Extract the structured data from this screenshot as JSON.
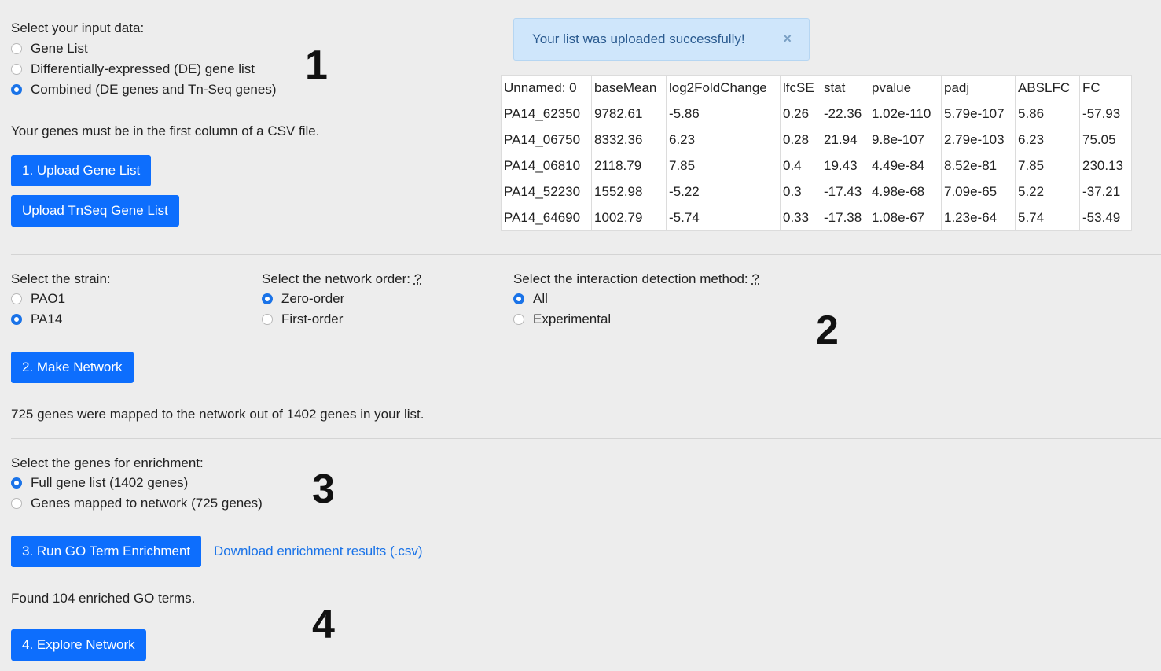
{
  "section1": {
    "prompt": "Select your input data:",
    "options": [
      "Gene List",
      "Differentially-expressed (DE) gene list",
      "Combined (DE genes and Tn-Seq genes)"
    ],
    "selected_index": 2,
    "note": "Your genes must be in the first column of a CSV file.",
    "upload_button": "1. Upload Gene List",
    "upload_tnseq_button": "Upload TnSeq Gene List",
    "marker": "1"
  },
  "alert": {
    "message": "Your list was uploaded successfully!",
    "close_glyph": "×"
  },
  "table": {
    "headers": [
      "Unnamed: 0",
      "baseMean",
      "log2FoldChange",
      "lfcSE",
      "stat",
      "pvalue",
      "padj",
      "ABSLFC",
      "FC"
    ],
    "rows": [
      [
        "PA14_62350",
        "9782.61",
        "-5.86",
        "0.26",
        "-22.36",
        "1.02e-110",
        "5.79e-107",
        "5.86",
        "-57.93"
      ],
      [
        "PA14_06750",
        "8332.36",
        "6.23",
        "0.28",
        "21.94",
        "9.8e-107",
        "2.79e-103",
        "6.23",
        "75.05"
      ],
      [
        "PA14_06810",
        "2118.79",
        "7.85",
        "0.4",
        "19.43",
        "4.49e-84",
        "8.52e-81",
        "7.85",
        "230.13"
      ],
      [
        "PA14_52230",
        "1552.98",
        "-5.22",
        "0.3",
        "-17.43",
        "4.98e-68",
        "7.09e-65",
        "5.22",
        "-37.21"
      ],
      [
        "PA14_64690",
        "1002.79",
        "-5.74",
        "0.33",
        "-17.38",
        "1.08e-67",
        "1.23e-64",
        "5.74",
        "-53.49"
      ]
    ]
  },
  "section2": {
    "strain_prompt": "Select the strain:",
    "strain_options": [
      "PAO1",
      "PA14"
    ],
    "strain_selected_index": 1,
    "order_prompt": "Select the network order:",
    "order_options": [
      "Zero-order",
      "First-order"
    ],
    "order_selected_index": 0,
    "method_prompt": "Select the interaction detection method:",
    "method_options": [
      "All",
      "Experimental"
    ],
    "method_selected_index": 0,
    "help_glyph": "?",
    "make_button": "2. Make Network",
    "mapped_text": "725 genes were mapped to the network out of 1402 genes in your list.",
    "marker": "2"
  },
  "section3": {
    "prompt": "Select the genes for enrichment:",
    "options": [
      "Full gene list (1402 genes)",
      "Genes mapped to network (725 genes)"
    ],
    "selected_index": 0,
    "run_button": "3. Run GO Term Enrichment",
    "download_link": "Download enrichment results (.csv)",
    "found_text": "Found 104 enriched GO terms.",
    "marker": "3"
  },
  "section4": {
    "explore_button": "4. Explore Network",
    "marker": "4"
  },
  "colors": {
    "button": "#0d6efd",
    "radio_selected": "#1a73e8",
    "link": "#1a73e8",
    "alert_bg": "#cfe6fb",
    "page_bg": "#ededed"
  }
}
